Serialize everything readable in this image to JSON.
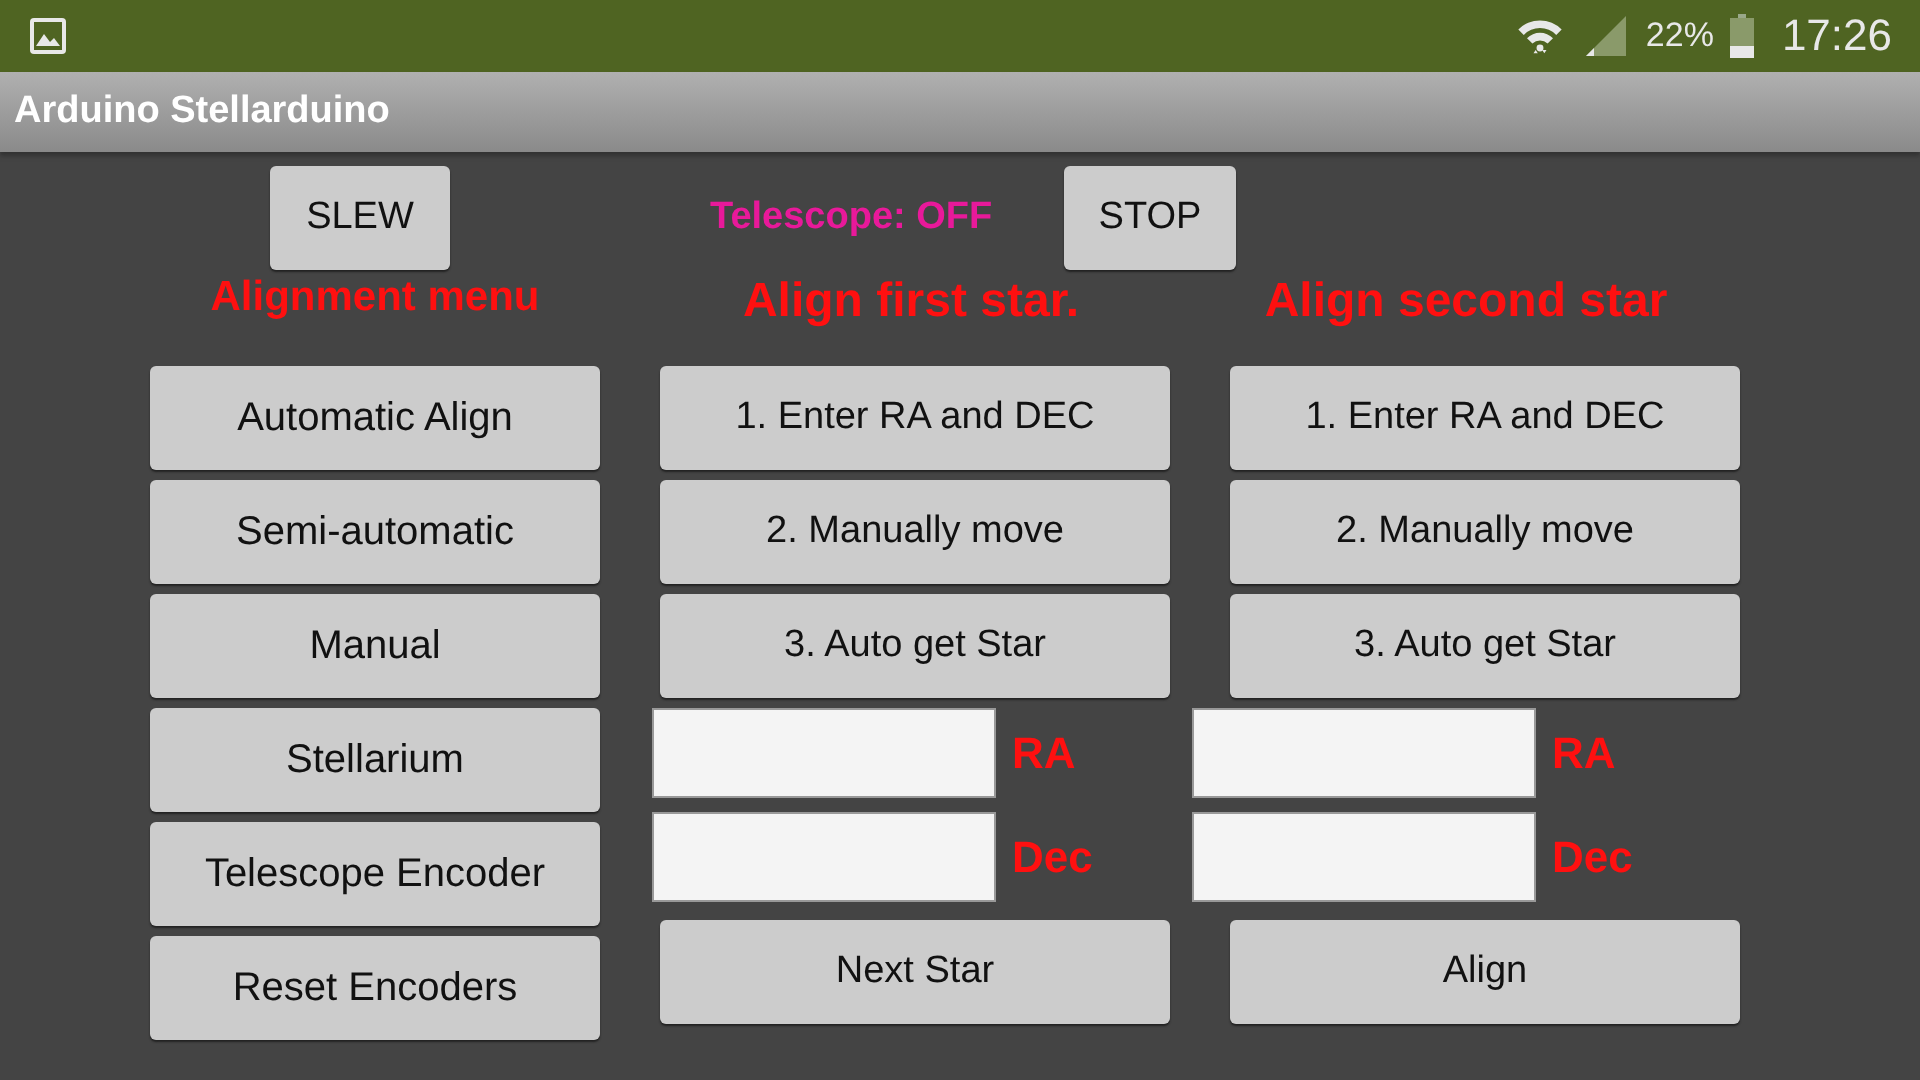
{
  "status_bar": {
    "battery": "22%",
    "time": "17:26"
  },
  "app_bar": {
    "title": "Arduino Stellarduino"
  },
  "toolbar": {
    "slew_button": "SLEW",
    "telescope_status": "Telescope: OFF",
    "stop_button": "STOP"
  },
  "alignment_menu": {
    "heading": "Alignment menu",
    "buttons": [
      "Automatic Align",
      "Semi-automatic",
      "Manual",
      "Stellarium",
      "Telescope Encoder",
      "Reset Encoders"
    ]
  },
  "first_star": {
    "heading": "Align first star.",
    "steps": [
      "1. Enter RA and DEC",
      "2. Manually move",
      "3. Auto get Star"
    ],
    "fields": [
      {
        "label": "RA"
      },
      {
        "label": "Dec"
      }
    ],
    "action": "Next Star"
  },
  "second_star": {
    "heading": "Align second star",
    "steps": [
      "1. Enter RA and DEC",
      "2. Manually move",
      "3. Auto get Star"
    ],
    "fields": [
      {
        "label": "RA"
      },
      {
        "label": "Dec"
      }
    ],
    "action": "Align"
  }
}
